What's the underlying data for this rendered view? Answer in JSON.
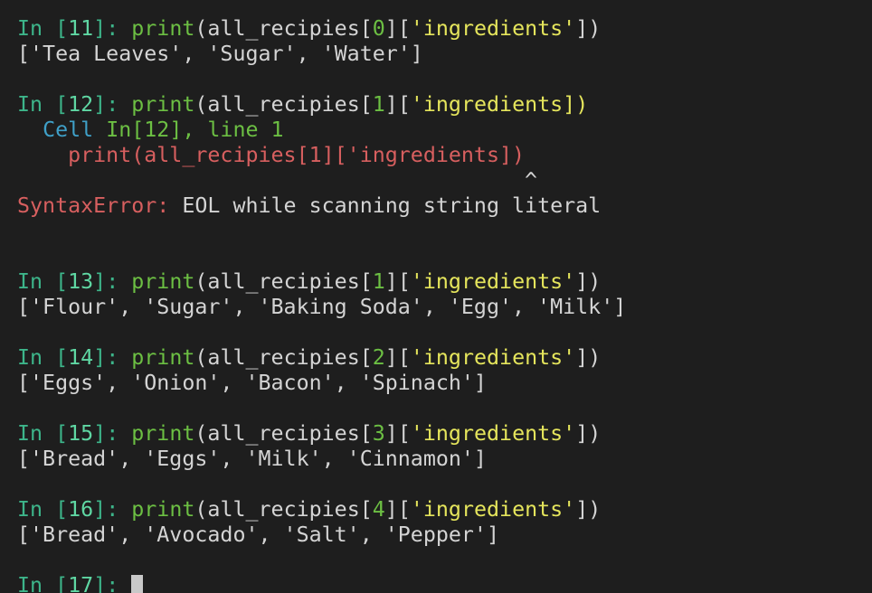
{
  "colors": {
    "background": "#1e1e1e",
    "text": "#d4d4d4",
    "prompt": "#3db58a",
    "prompt_number": "#5fd7a3",
    "builtin": "#6cbf43",
    "string": "#e5e55c",
    "error": "#d75f5f",
    "cell_info": "#3fa0c8",
    "cursor": "#c8c8c8"
  },
  "lines": [
    {
      "tokens": [
        {
          "t": "In [",
          "c": "prompt"
        },
        {
          "t": "11",
          "c": "prompt_number"
        },
        {
          "t": "]: ",
          "c": "prompt"
        },
        {
          "t": "print",
          "c": "builtin"
        },
        {
          "t": "(all_recipies[",
          "c": "text"
        },
        {
          "t": "0",
          "c": "builtin"
        },
        {
          "t": "][",
          "c": "text"
        },
        {
          "t": "'ingredients'",
          "c": "string"
        },
        {
          "t": "])",
          "c": "text"
        }
      ]
    },
    {
      "tokens": [
        {
          "t": "['Tea Leaves', 'Sugar', 'Water']",
          "c": "text"
        }
      ]
    },
    {
      "tokens": []
    },
    {
      "tokens": [
        {
          "t": "In [",
          "c": "prompt"
        },
        {
          "t": "12",
          "c": "prompt_number"
        },
        {
          "t": "]: ",
          "c": "prompt"
        },
        {
          "t": "print",
          "c": "builtin"
        },
        {
          "t": "(all_recipies[",
          "c": "text"
        },
        {
          "t": "1",
          "c": "builtin"
        },
        {
          "t": "][",
          "c": "text"
        },
        {
          "t": "'ingredients])",
          "c": "string"
        }
      ]
    },
    {
      "tokens": [
        {
          "t": "  ",
          "c": "text"
        },
        {
          "t": "Cell ",
          "c": "cell_info"
        },
        {
          "t": "In[12], line 1",
          "c": "builtin"
        }
      ]
    },
    {
      "tokens": [
        {
          "t": "    print(all_recipies[1]['ingredients])",
          "c": "error"
        }
      ]
    },
    {
      "tokens": [
        {
          "t": "                                        ^",
          "c": "text"
        }
      ]
    },
    {
      "tokens": [
        {
          "t": "SyntaxError:",
          "c": "error"
        },
        {
          "t": " EOL while scanning string literal",
          "c": "text"
        }
      ]
    },
    {
      "tokens": []
    },
    {
      "tokens": []
    },
    {
      "tokens": [
        {
          "t": "In [",
          "c": "prompt"
        },
        {
          "t": "13",
          "c": "prompt_number"
        },
        {
          "t": "]: ",
          "c": "prompt"
        },
        {
          "t": "print",
          "c": "builtin"
        },
        {
          "t": "(all_recipies[",
          "c": "text"
        },
        {
          "t": "1",
          "c": "builtin"
        },
        {
          "t": "][",
          "c": "text"
        },
        {
          "t": "'ingredients'",
          "c": "string"
        },
        {
          "t": "])",
          "c": "text"
        }
      ]
    },
    {
      "tokens": [
        {
          "t": "['Flour', 'Sugar', 'Baking Soda', 'Egg', 'Milk']",
          "c": "text"
        }
      ]
    },
    {
      "tokens": []
    },
    {
      "tokens": [
        {
          "t": "In [",
          "c": "prompt"
        },
        {
          "t": "14",
          "c": "prompt_number"
        },
        {
          "t": "]: ",
          "c": "prompt"
        },
        {
          "t": "print",
          "c": "builtin"
        },
        {
          "t": "(all_recipies[",
          "c": "text"
        },
        {
          "t": "2",
          "c": "builtin"
        },
        {
          "t": "][",
          "c": "text"
        },
        {
          "t": "'ingredients'",
          "c": "string"
        },
        {
          "t": "])",
          "c": "text"
        }
      ]
    },
    {
      "tokens": [
        {
          "t": "['Eggs', 'Onion', 'Bacon', 'Spinach']",
          "c": "text"
        }
      ]
    },
    {
      "tokens": []
    },
    {
      "tokens": [
        {
          "t": "In [",
          "c": "prompt"
        },
        {
          "t": "15",
          "c": "prompt_number"
        },
        {
          "t": "]: ",
          "c": "prompt"
        },
        {
          "t": "print",
          "c": "builtin"
        },
        {
          "t": "(all_recipies[",
          "c": "text"
        },
        {
          "t": "3",
          "c": "builtin"
        },
        {
          "t": "][",
          "c": "text"
        },
        {
          "t": "'ingredients'",
          "c": "string"
        },
        {
          "t": "])",
          "c": "text"
        }
      ]
    },
    {
      "tokens": [
        {
          "t": "['Bread', 'Eggs', 'Milk', 'Cinnamon']",
          "c": "text"
        }
      ]
    },
    {
      "tokens": []
    },
    {
      "tokens": [
        {
          "t": "In [",
          "c": "prompt"
        },
        {
          "t": "16",
          "c": "prompt_number"
        },
        {
          "t": "]: ",
          "c": "prompt"
        },
        {
          "t": "print",
          "c": "builtin"
        },
        {
          "t": "(all_recipies[",
          "c": "text"
        },
        {
          "t": "4",
          "c": "builtin"
        },
        {
          "t": "][",
          "c": "text"
        },
        {
          "t": "'ingredients'",
          "c": "string"
        },
        {
          "t": "])",
          "c": "text"
        }
      ]
    },
    {
      "tokens": [
        {
          "t": "['Bread', 'Avocado', 'Salt', 'Pepper']",
          "c": "text"
        }
      ]
    },
    {
      "tokens": []
    },
    {
      "tokens": [
        {
          "t": "In [",
          "c": "prompt"
        },
        {
          "t": "17",
          "c": "prompt_number"
        },
        {
          "t": "]: ",
          "c": "prompt"
        }
      ],
      "cursor": true
    }
  ]
}
